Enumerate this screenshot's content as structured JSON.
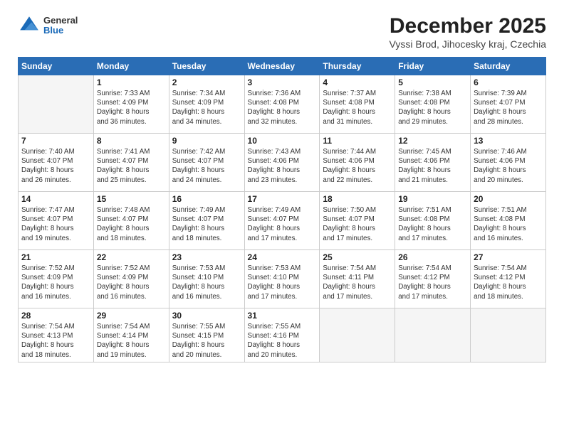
{
  "header": {
    "logo": {
      "general": "General",
      "blue": "Blue"
    },
    "title": "December 2025",
    "subtitle": "Vyssi Brod, Jihocesky kraj, Czechia"
  },
  "calendar": {
    "days_of_week": [
      "Sunday",
      "Monday",
      "Tuesday",
      "Wednesday",
      "Thursday",
      "Friday",
      "Saturday"
    ],
    "weeks": [
      [
        {
          "day": "",
          "info": ""
        },
        {
          "day": "1",
          "info": "Sunrise: 7:33 AM\nSunset: 4:09 PM\nDaylight: 8 hours\nand 36 minutes."
        },
        {
          "day": "2",
          "info": "Sunrise: 7:34 AM\nSunset: 4:09 PM\nDaylight: 8 hours\nand 34 minutes."
        },
        {
          "day": "3",
          "info": "Sunrise: 7:36 AM\nSunset: 4:08 PM\nDaylight: 8 hours\nand 32 minutes."
        },
        {
          "day": "4",
          "info": "Sunrise: 7:37 AM\nSunset: 4:08 PM\nDaylight: 8 hours\nand 31 minutes."
        },
        {
          "day": "5",
          "info": "Sunrise: 7:38 AM\nSunset: 4:08 PM\nDaylight: 8 hours\nand 29 minutes."
        },
        {
          "day": "6",
          "info": "Sunrise: 7:39 AM\nSunset: 4:07 PM\nDaylight: 8 hours\nand 28 minutes."
        }
      ],
      [
        {
          "day": "7",
          "info": "Sunrise: 7:40 AM\nSunset: 4:07 PM\nDaylight: 8 hours\nand 26 minutes."
        },
        {
          "day": "8",
          "info": "Sunrise: 7:41 AM\nSunset: 4:07 PM\nDaylight: 8 hours\nand 25 minutes."
        },
        {
          "day": "9",
          "info": "Sunrise: 7:42 AM\nSunset: 4:07 PM\nDaylight: 8 hours\nand 24 minutes."
        },
        {
          "day": "10",
          "info": "Sunrise: 7:43 AM\nSunset: 4:06 PM\nDaylight: 8 hours\nand 23 minutes."
        },
        {
          "day": "11",
          "info": "Sunrise: 7:44 AM\nSunset: 4:06 PM\nDaylight: 8 hours\nand 22 minutes."
        },
        {
          "day": "12",
          "info": "Sunrise: 7:45 AM\nSunset: 4:06 PM\nDaylight: 8 hours\nand 21 minutes."
        },
        {
          "day": "13",
          "info": "Sunrise: 7:46 AM\nSunset: 4:06 PM\nDaylight: 8 hours\nand 20 minutes."
        }
      ],
      [
        {
          "day": "14",
          "info": "Sunrise: 7:47 AM\nSunset: 4:07 PM\nDaylight: 8 hours\nand 19 minutes."
        },
        {
          "day": "15",
          "info": "Sunrise: 7:48 AM\nSunset: 4:07 PM\nDaylight: 8 hours\nand 18 minutes."
        },
        {
          "day": "16",
          "info": "Sunrise: 7:49 AM\nSunset: 4:07 PM\nDaylight: 8 hours\nand 18 minutes."
        },
        {
          "day": "17",
          "info": "Sunrise: 7:49 AM\nSunset: 4:07 PM\nDaylight: 8 hours\nand 17 minutes."
        },
        {
          "day": "18",
          "info": "Sunrise: 7:50 AM\nSunset: 4:07 PM\nDaylight: 8 hours\nand 17 minutes."
        },
        {
          "day": "19",
          "info": "Sunrise: 7:51 AM\nSunset: 4:08 PM\nDaylight: 8 hours\nand 17 minutes."
        },
        {
          "day": "20",
          "info": "Sunrise: 7:51 AM\nSunset: 4:08 PM\nDaylight: 8 hours\nand 16 minutes."
        }
      ],
      [
        {
          "day": "21",
          "info": "Sunrise: 7:52 AM\nSunset: 4:09 PM\nDaylight: 8 hours\nand 16 minutes."
        },
        {
          "day": "22",
          "info": "Sunrise: 7:52 AM\nSunset: 4:09 PM\nDaylight: 8 hours\nand 16 minutes."
        },
        {
          "day": "23",
          "info": "Sunrise: 7:53 AM\nSunset: 4:10 PM\nDaylight: 8 hours\nand 16 minutes."
        },
        {
          "day": "24",
          "info": "Sunrise: 7:53 AM\nSunset: 4:10 PM\nDaylight: 8 hours\nand 17 minutes."
        },
        {
          "day": "25",
          "info": "Sunrise: 7:54 AM\nSunset: 4:11 PM\nDaylight: 8 hours\nand 17 minutes."
        },
        {
          "day": "26",
          "info": "Sunrise: 7:54 AM\nSunset: 4:12 PM\nDaylight: 8 hours\nand 17 minutes."
        },
        {
          "day": "27",
          "info": "Sunrise: 7:54 AM\nSunset: 4:12 PM\nDaylight: 8 hours\nand 18 minutes."
        }
      ],
      [
        {
          "day": "28",
          "info": "Sunrise: 7:54 AM\nSunset: 4:13 PM\nDaylight: 8 hours\nand 18 minutes."
        },
        {
          "day": "29",
          "info": "Sunrise: 7:54 AM\nSunset: 4:14 PM\nDaylight: 8 hours\nand 19 minutes."
        },
        {
          "day": "30",
          "info": "Sunrise: 7:55 AM\nSunset: 4:15 PM\nDaylight: 8 hours\nand 20 minutes."
        },
        {
          "day": "31",
          "info": "Sunrise: 7:55 AM\nSunset: 4:16 PM\nDaylight: 8 hours\nand 20 minutes."
        },
        {
          "day": "",
          "info": ""
        },
        {
          "day": "",
          "info": ""
        },
        {
          "day": "",
          "info": ""
        }
      ]
    ]
  }
}
